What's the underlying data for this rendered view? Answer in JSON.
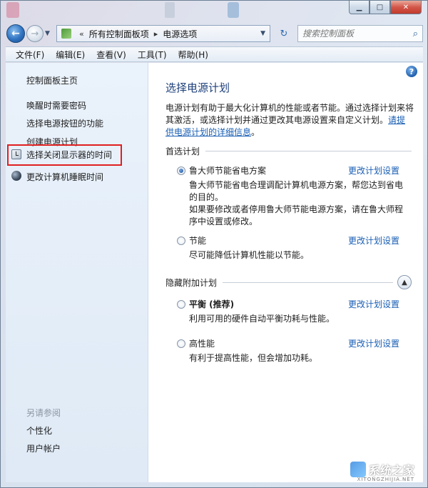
{
  "address": {
    "crumbs": [
      "所有控制面板项",
      "电源选项"
    ],
    "overflow": "«"
  },
  "search": {
    "placeholder": "搜索控制面板"
  },
  "menu": [
    "文件(F)",
    "编辑(E)",
    "查看(V)",
    "工具(T)",
    "帮助(H)"
  ],
  "sidebar": {
    "home": "控制面板主页",
    "links": [
      "唤醒时需要密码",
      "选择电源按钮的功能",
      "创建电源计划",
      "选择关闭显示器的时间",
      "更改计算机睡眠时间"
    ],
    "see_also_title": "另请参阅",
    "see_also": [
      "个性化",
      "用户帐户"
    ]
  },
  "main": {
    "title": "选择电源计划",
    "intro": "电源计划有助于最大化计算机的性能或者节能。通过选择计划来将其激活，或选择计划并通过更改其电源设置来自定义计划。",
    "intro_link": "请提供电源计划的详细信息",
    "intro_end": "。",
    "preferred_title": "首选计划",
    "hidden_title": "隐藏附加计划",
    "change_link": "更改计划设置",
    "plans": [
      {
        "name": "鲁大师节能省电方案",
        "desc": "鲁大师节能省电合理调配计算机电源方案，帮您达到省电的目的。\n如果要修改或者停用鲁大师节能电源方案，请在鲁大师程序中设置或修改。",
        "checked": true
      },
      {
        "name": "节能",
        "desc": "尽可能降低计算机性能以节能。",
        "checked": false
      },
      {
        "name": "平衡 (推荐)",
        "desc": "利用可用的硬件自动平衡功耗与性能。",
        "checked": false
      },
      {
        "name": "高性能",
        "desc": "有利于提高性能，但会增加功耗。",
        "checked": false
      }
    ]
  },
  "watermark": {
    "text": "系统之家",
    "sub": "XITONGZHIJIA.NET"
  },
  "icons": [
    "back-arrow-icon",
    "forward-arrow-icon",
    "refresh-icon",
    "search-icon",
    "help-icon",
    "clock-icon",
    "moon-icon"
  ]
}
